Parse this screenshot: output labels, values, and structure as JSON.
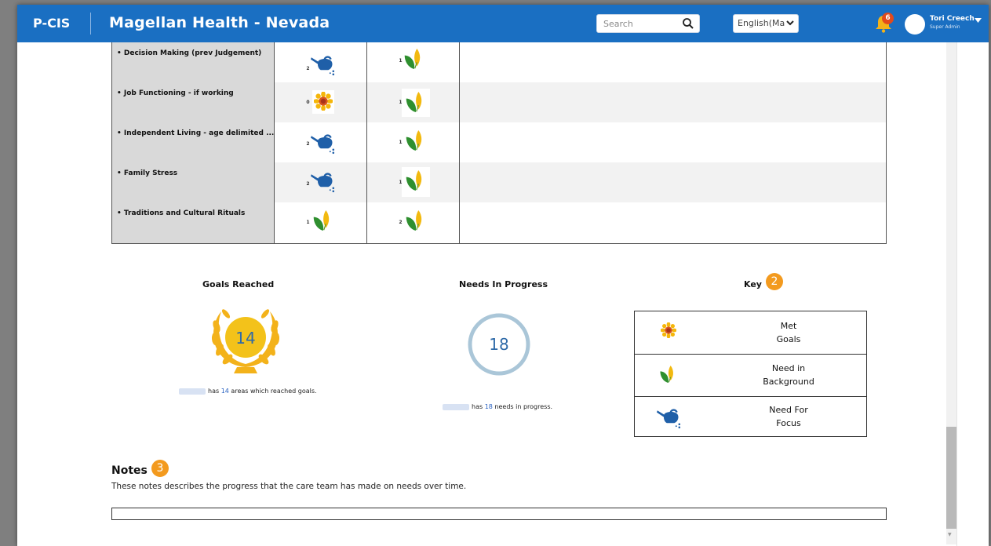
{
  "header": {
    "brand": "P-CIS",
    "org_name": "Magellan Health - Nevada",
    "search_placeholder": "Search",
    "language": "English(Maį",
    "notification_count": "6",
    "user_name": "Tori Creech",
    "user_role": "Super Admin"
  },
  "table": {
    "rows": [
      {
        "label": "• Decision Making (prev Judgement)",
        "col1_num": "2",
        "col1_icon": "watering-can-icon",
        "col2_num": "1",
        "col2_icon": "leaf-sprout-icon"
      },
      {
        "label": "• Job Functioning - if working",
        "col1_num": "0",
        "col1_icon": "sunflower-icon",
        "col2_num": "1",
        "col2_icon": "leaf-sprout-icon"
      },
      {
        "label": "• Independent Living - age delimited ...",
        "col1_num": "2",
        "col1_icon": "watering-can-icon",
        "col2_num": "1",
        "col2_icon": "leaf-sprout-icon"
      },
      {
        "label": "• Family Stress",
        "col1_num": "2",
        "col1_icon": "watering-can-icon",
        "col2_num": "1",
        "col2_icon": "leaf-sprout-icon"
      },
      {
        "label": "• Traditions and Cultural Rituals",
        "col1_num": "1",
        "col1_icon": "leaf-sprout-icon",
        "col2_num": "2",
        "col2_icon": "leaf-sprout-icon"
      }
    ]
  },
  "goals": {
    "title": "Goals Reached",
    "count": "14",
    "text_prefix": "has",
    "text_suffix": "areas which reached goals."
  },
  "needs": {
    "title": "Needs In Progress",
    "count": "18",
    "text_prefix": "has",
    "text_suffix": "needs in progress."
  },
  "key": {
    "title": "Key",
    "callout": "2",
    "items": [
      {
        "line1": "Met",
        "line2": "Goals",
        "icon": "sunflower-icon"
      },
      {
        "line1": "Need in",
        "line2": "Background",
        "icon": "leaf-sprout-icon"
      },
      {
        "line1": "Need For",
        "line2": "Focus",
        "icon": "watering-can-icon"
      }
    ]
  },
  "notes": {
    "title": "Notes",
    "callout": "3",
    "description": "These notes describes the progress that the care team has made on needs over time.",
    "value": ""
  },
  "colors": {
    "header_bg": "#1a6fc2",
    "callout": "#f39a1e",
    "badge": "#e24a1c",
    "link_number": "#2a62c2"
  }
}
